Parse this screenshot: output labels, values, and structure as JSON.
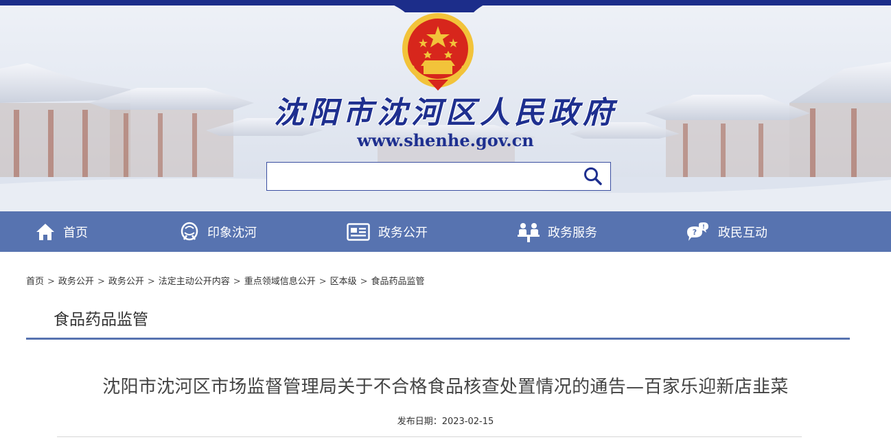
{
  "header": {
    "site_title": "沈阳市沈河区人民政府",
    "site_url": "www.shenhe.gov.cn",
    "emblem_icon": "national-emblem-icon",
    "search": {
      "placeholder": "",
      "value": "",
      "icon": "search-icon"
    }
  },
  "nav": {
    "items": [
      {
        "label": "首页",
        "icon": "home-icon"
      },
      {
        "label": "印象沈河",
        "icon": "impression-icon"
      },
      {
        "label": "政务公开",
        "icon": "newspaper-icon"
      },
      {
        "label": "政务服务",
        "icon": "service-desk-icon"
      },
      {
        "label": "政民互动",
        "icon": "chat-bubble-icon"
      }
    ]
  },
  "breadcrumb": {
    "items": [
      "首页",
      "政务公开",
      "政务公开",
      "法定主动公开内容",
      "重点领域信息公开",
      "区本级",
      "食品药品监管"
    ],
    "separator": ">"
  },
  "section": {
    "title": "食品药品监管"
  },
  "article": {
    "title": "沈阳市沈河区市场监督管理局关于不合格食品核查处置情况的通告—百家乐迎新店韭菜",
    "date_label": "发布日期：",
    "date": "2023-02-15"
  },
  "colors": {
    "brand_blue": "#1e2f8f",
    "nav_bg": "#5773b0",
    "top_strip": "#1c2d8a",
    "emblem_red": "#d7261c",
    "emblem_gold": "#f2c33a"
  }
}
